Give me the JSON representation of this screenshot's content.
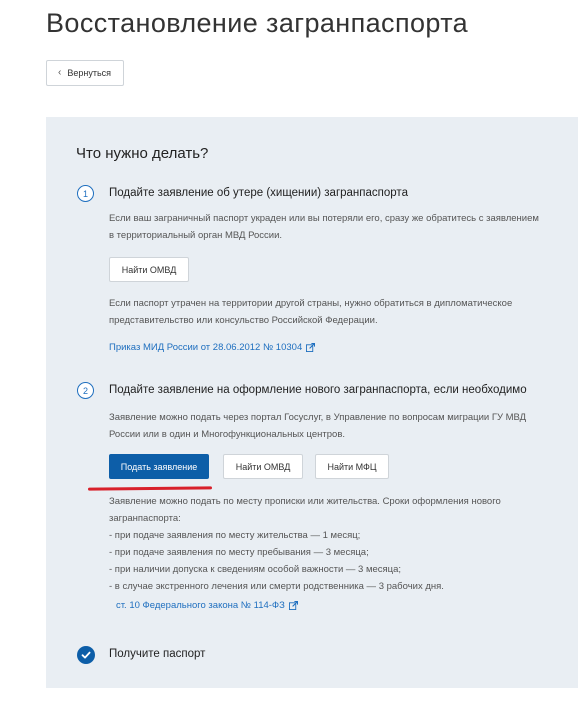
{
  "page": {
    "title": "Восстановление загранпаспорта"
  },
  "back": {
    "label": "Вернуться"
  },
  "panel": {
    "title": "Что нужно делать?"
  },
  "step1": {
    "number": "1",
    "title": "Подайте заявление об утере (хищении) загранпаспорта",
    "text1": "Если ваш заграничный паспорт украден или вы потеряли его, сразу же обратитесь с заявлением в территориальный орган МВД России.",
    "button": "Найти ОМВД",
    "text2": "Если паспорт утрачен на территории другой страны, нужно обратиться в дипломатическое представительство или консульство Российской Федерации.",
    "link": "Приказ МИД России от 28.06.2012 № 10304"
  },
  "step2": {
    "number": "2",
    "title": "Подайте заявление на оформление нового загранпаспорта, если необходимо",
    "text1": "Заявление можно подать через портал Госуслуг, в Управление по вопросам миграции ГУ МВД России или в один и Многофункциональных центров.",
    "buttons": {
      "apply": "Подать заявление",
      "omvd": "Найти ОМВД",
      "mfc": "Найти МФЦ"
    },
    "text2": {
      "intro": "Заявление можно подать по месту прописки или жительства. Сроки оформления нового загранпаспорта:",
      "items": [
        "- при подаче заявления по месту жительства — 1 месяц;",
        "- при подаче заявления по месту пребывания — 3 месяца;",
        "- при наличии допуска к сведениям особой важности — 3 месяца;",
        "- в случае экстренного лечения или смерти родственника — 3 рабочих дня."
      ]
    },
    "link": "ст. 10 Федерального закона № 114-ФЗ"
  },
  "step3": {
    "title": "Получите паспорт"
  },
  "colors": {
    "accent": "#0d5ea8",
    "link": "#1f6fbf",
    "panel_bg": "#e9eef3",
    "highlight": "#d8202a"
  },
  "icons": {
    "back": "chevron-left-icon",
    "external": "external-link-icon",
    "done": "checkmark-icon"
  }
}
